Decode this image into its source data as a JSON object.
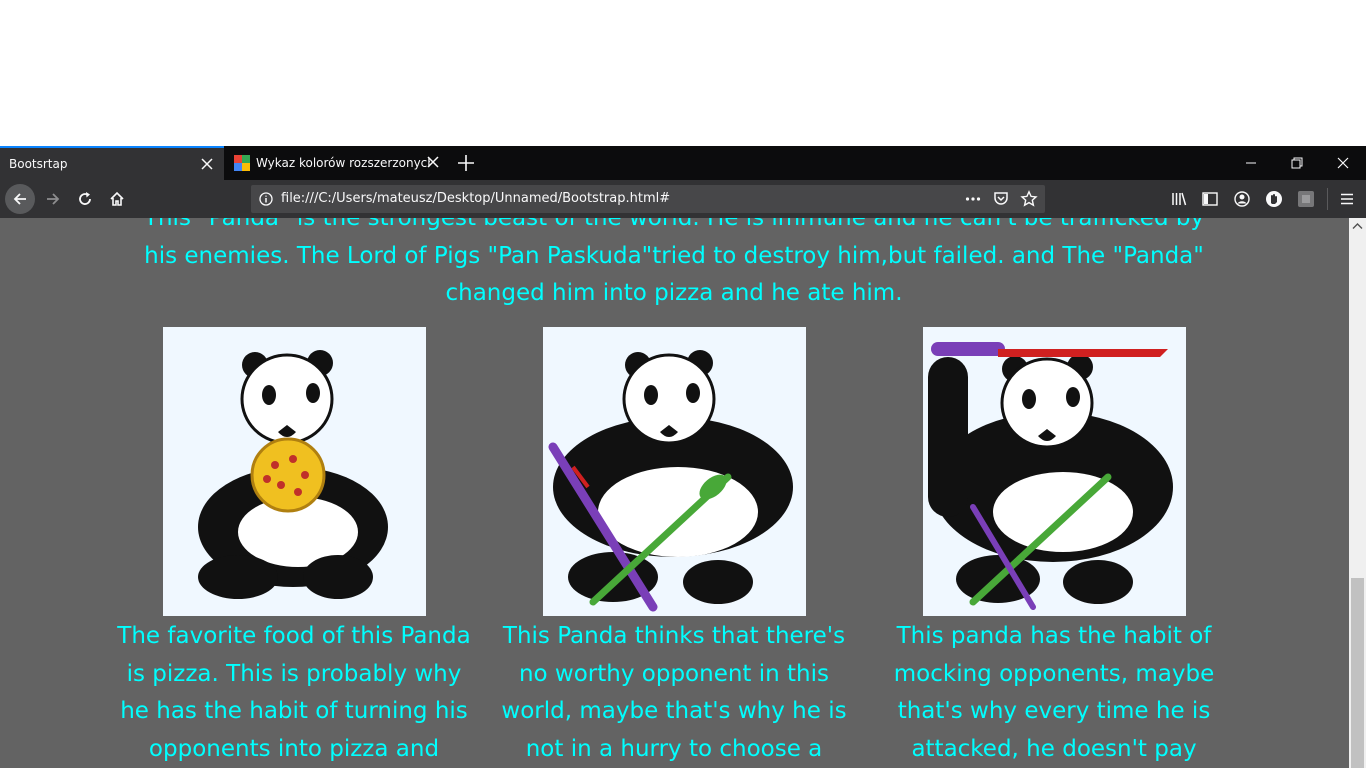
{
  "tabs": [
    {
      "label": "Bootsrtap"
    },
    {
      "label": "Wykaz kolorów rozszerzonych -"
    }
  ],
  "url": "file:///C:/Users/mateusz/Desktop/Unnamed/Bootstrap.html#",
  "page": {
    "intro": "This \"Panda\" is the strongest beast of the world. He is immune and he can't be trafficked by his enemies. The Lord of Pigs \"Pan Paskuda\"tried to destroy him,but failed. and The \"Panda\" changed him into pizza and he ate him.",
    "cards": [
      {
        "caption": "The favorite food of this Panda is pizza. This is probably why he has the habit of turning his opponents into pizza and"
      },
      {
        "caption": "This Panda thinks that there's no worthy opponent in this world, maybe that's why he is not in a hurry to choose a"
      },
      {
        "caption": "This panda has the habit of mocking opponents, maybe that's why every time he is attacked, he doesn't pay"
      }
    ]
  },
  "colors": {
    "text_accent": "#00ffff",
    "page_bg": "#636363",
    "tab_accent": "#0a84ff"
  },
  "icons": [
    "close-icon",
    "favicon-icon",
    "plus-icon",
    "minimize-icon",
    "restore-icon",
    "close-window-icon",
    "back-icon",
    "forward-icon",
    "reload-icon",
    "home-icon",
    "info-icon",
    "more-icon",
    "pocket-icon",
    "star-icon",
    "library-icon",
    "sidebar-icon",
    "account-icon",
    "extension-icon",
    "menu-icon"
  ]
}
